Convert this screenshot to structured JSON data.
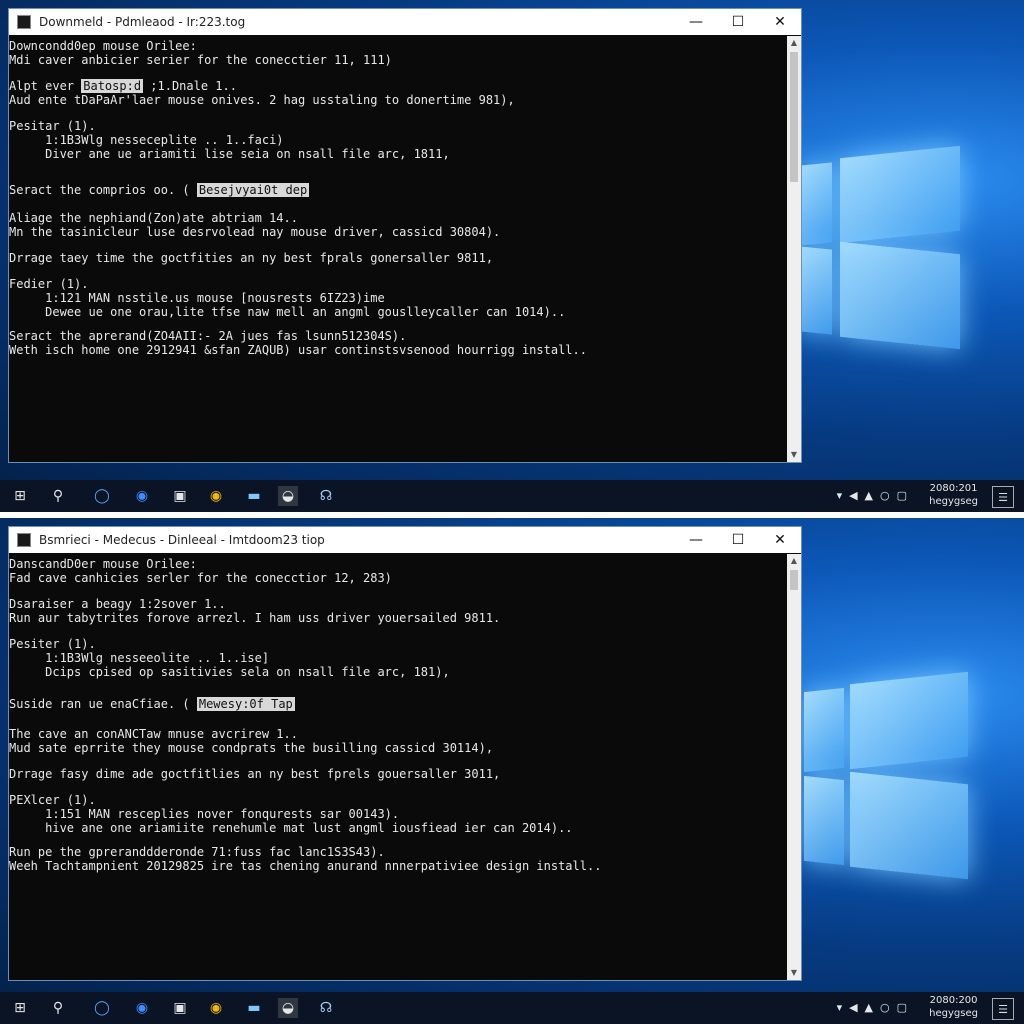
{
  "top": {
    "window": {
      "title": "Downmeld - Pdmleaod - Ir:223.tog",
      "lines": [
        {
          "pre": "Downcondd0ep mouse Orilee:"
        },
        {
          "pre": "Mdi caver anbicier serier for the conecctier 11, 111)"
        },
        {
          "pre": "Alpt ever ",
          "hl": "Batosp:d",
          "post": " ;1.Dnale 1.."
        },
        {
          "pre": "Aud ente tDaPaAr'laer mouse onives. 2 hag usstaling to donertime 981),"
        },
        {
          "pre": "Pesitar (1)."
        },
        {
          "pre": "     1:1B3Wlg nesseceplite .. 1..faci)"
        },
        {
          "pre": "     Diver ane ue ariamiti lise seia on nsall file arc, 1811,"
        },
        {
          "pre": "Seract the comprios oo. ( ",
          "hl": "Besejvyai0t dep"
        },
        {
          "pre": "Aliage the nephiand(Zon)ate abtriam 14.."
        },
        {
          "pre": "Mn the tasinicleur luse desrvolead nay mouse driver, cassicd 30804)."
        },
        {
          "pre": "Drrage taey time the goctfities an ny best fprals gonersaller 9811,"
        },
        {
          "pre": "Fedier (1)."
        },
        {
          "pre": "     1:121 MAN nsstile.us mouse [nousrests 6IZ23)ime"
        },
        {
          "pre": "     Dewee ue one orau,lite tfse naw mell an angml gouslleycaller can 1014).."
        },
        {
          "pre": "Seract the aprerand(ZO4AII:- 2A jues fas lsunn512304S)."
        },
        {
          "pre": "Weth isch home one 2912941 &sfan ZAQUB) usar continstsvsenood hourrigg install.."
        }
      ]
    },
    "taskbar": {
      "clock_time": "2080:201",
      "clock_date": "hegygseg"
    }
  },
  "bottom": {
    "window": {
      "title": "Bsmrieci - Medecus - Dinleeal - Imtdoom23 tiop",
      "lines": [
        {
          "pre": "DanscandD0er mouse Orilee:"
        },
        {
          "pre": "Fad cave canhicies serler for the conecctior 12, 283)"
        },
        {
          "pre": "Dsaraiser a beagy 1:2sover 1.."
        },
        {
          "pre": "Run aur tabytrites forove arrezl. I ham uss driver youersailed 9811."
        },
        {
          "pre": "Pesiter (1)."
        },
        {
          "pre": "     1:1B3Wlg nesseeolite .. 1..ise]"
        },
        {
          "pre": "     Dcips cpised op sasitivies sela on nsall file arc, 181),"
        },
        {
          "pre": "Suside ran ue enaCfiae. ( ",
          "hl": "Mewesy:0f Tap"
        },
        {
          "pre": "The cave an conANCTaw mnuse avcrirew 1.."
        },
        {
          "pre": "Mud sate eprrite they mouse condprats the busilling cassicd 30114),"
        },
        {
          "pre": "Drrage fasy dime ade goctfitlies an ny best fprels gouersaller 3011,"
        },
        {
          "pre": "PEXlcer (1)."
        },
        {
          "pre": "     1:151 MAN resceplies nover fonqurests sar 00143)."
        },
        {
          "pre": "     hive ane one ariamiite renehumle mat lust angml iousfiead ier can 2014).."
        },
        {
          "pre": "Run pe the gpreranddderonde 71:fuss fac lanc1S3S43)."
        },
        {
          "pre": "Weeh Tachtampnient 20129825 ire tas chening anurand nnnerpativiee design install.."
        }
      ]
    },
    "taskbar": {
      "clock_time": "2080:200",
      "clock_date": "hegygseg"
    }
  },
  "icons": {
    "start": "windows-start-icon",
    "search": "search-icon",
    "cortana": "cortana-icon",
    "edge": "edge-icon",
    "explorer": "file-explorer-icon",
    "chrome": "chrome-icon",
    "monitor": "monitor-icon",
    "store": "store-icon",
    "headset": "headset-icon"
  },
  "colors": {
    "console_bg": "#0a0a0a",
    "console_text": "#e8e8e8",
    "desktop_blue": "#0c58b8",
    "taskbar": "#0b1424"
  }
}
